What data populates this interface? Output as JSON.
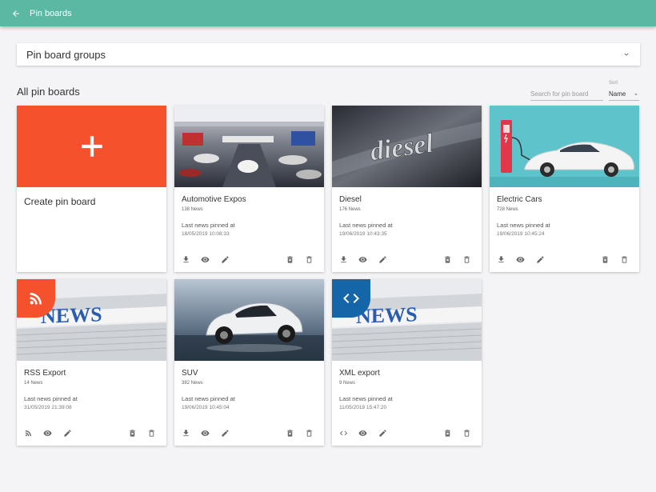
{
  "header": {
    "title": "Pin boards"
  },
  "groups": {
    "label": "Pin board groups"
  },
  "section": {
    "title": "All pin boards"
  },
  "search": {
    "placeholder": "Search for pin board"
  },
  "sort": {
    "label": "Sort",
    "value": "Name"
  },
  "create_card": {
    "label": "Create pin board",
    "color": "#f4512c"
  },
  "cards": [
    {
      "title": "Automotive Expos",
      "count": "138 News",
      "pinned_label": "Last news pinned at",
      "date": "18/05/2019 10:08:33",
      "image": "auto-show-photo"
    },
    {
      "title": "Diesel",
      "count": "176 News",
      "pinned_label": "Last news pinned at",
      "date": "19/06/2019 10:43:35",
      "image": "diesel-badge-photo",
      "image_text": "diesel"
    },
    {
      "title": "Electric Cars",
      "count": "728 News",
      "pinned_label": "Last news pinned at",
      "date": "19/06/2019 10:45:24",
      "image": "electric-car-illustration"
    },
    {
      "title": "RSS Export",
      "count": "14 News",
      "pinned_label": "Last news pinned at",
      "date": "31/05/2019 21:39:08",
      "image": "newspaper-photo",
      "badge": "rss-icon",
      "badge_color": "#f4512c",
      "image_text": "NEWS"
    },
    {
      "title": "SUV",
      "count": "382 News",
      "pinned_label": "Last news pinned at",
      "date": "19/06/2019 10:45:04",
      "image": "suv-photo"
    },
    {
      "title": "XML export",
      "count": "9 News",
      "pinned_label": "Last news pinned at",
      "date": "11/05/2019 15:47:20",
      "image": "newspaper-photo",
      "badge": "code-icon",
      "badge_color": "#1565a9",
      "image_text": "NEWS"
    }
  ],
  "colors": {
    "topbar": "#5bb8a3",
    "accent_orange": "#f4512c",
    "accent_blue": "#1565a9"
  }
}
